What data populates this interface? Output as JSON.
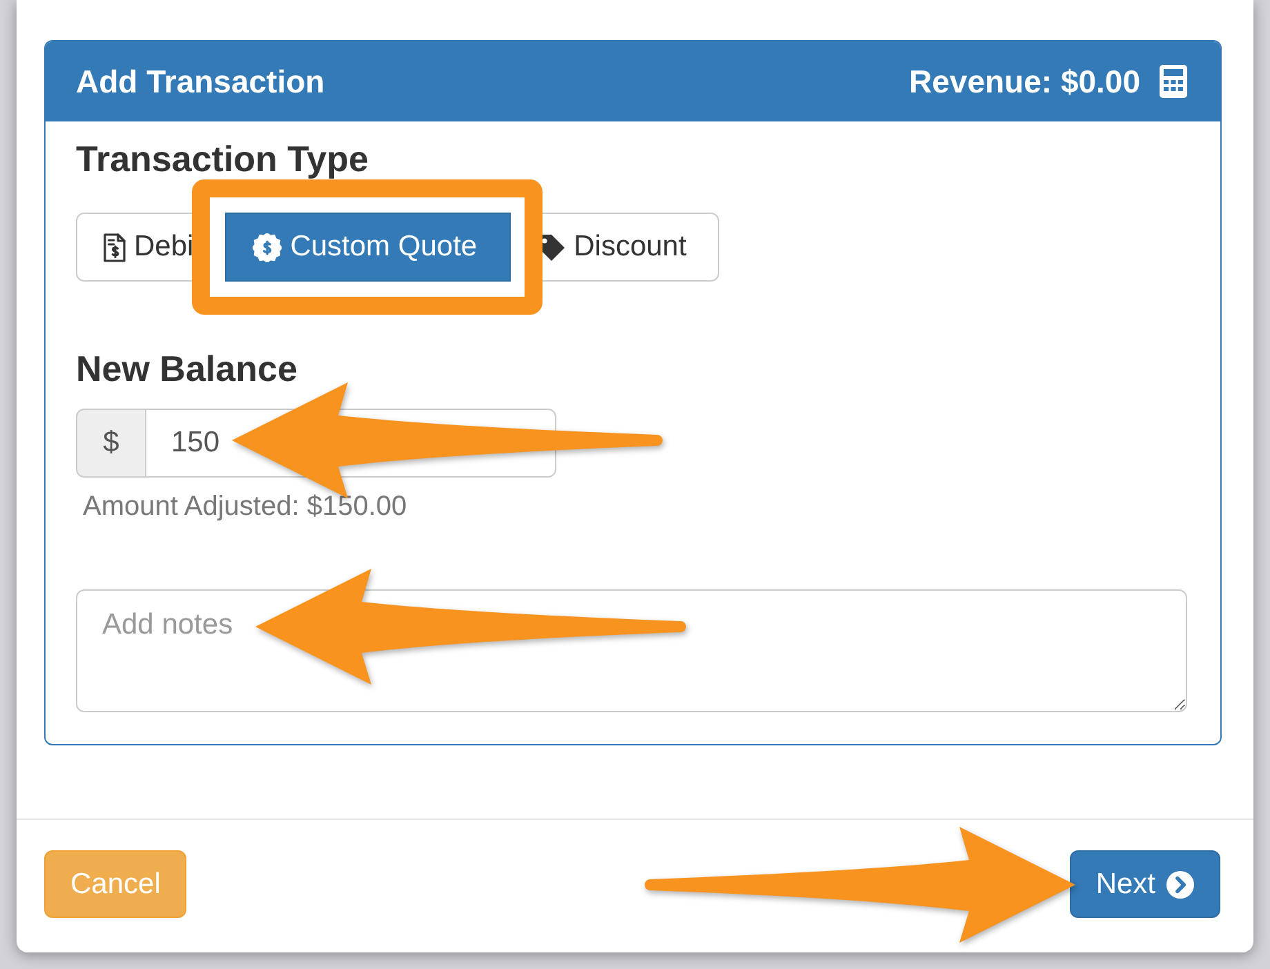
{
  "panel": {
    "title": "Add Transaction",
    "revenue": "Revenue: $0.00"
  },
  "transaction_type": {
    "label": "Transaction Type",
    "options": [
      {
        "kind": "debit",
        "label": "Debi",
        "selected": false,
        "highlighted": false
      },
      {
        "kind": "quote",
        "label": "Custom Quote",
        "selected": true,
        "highlighted": true
      },
      {
        "kind": "discount",
        "label": "Discount",
        "selected": false,
        "highlighted": false
      }
    ]
  },
  "new_balance": {
    "label": "New Balance",
    "prefix": "$",
    "value": "150",
    "callout_arrow": true,
    "note": "Amount Adjusted: $150.00"
  },
  "notes": {
    "placeholder": "Add notes",
    "callout_arrow": true
  },
  "footer": {
    "buttons": [
      {
        "kind": "cancel",
        "label": "Cancel",
        "callout_arrow": false
      },
      {
        "kind": "next",
        "label": "Next",
        "callout_arrow": true
      }
    ]
  }
}
